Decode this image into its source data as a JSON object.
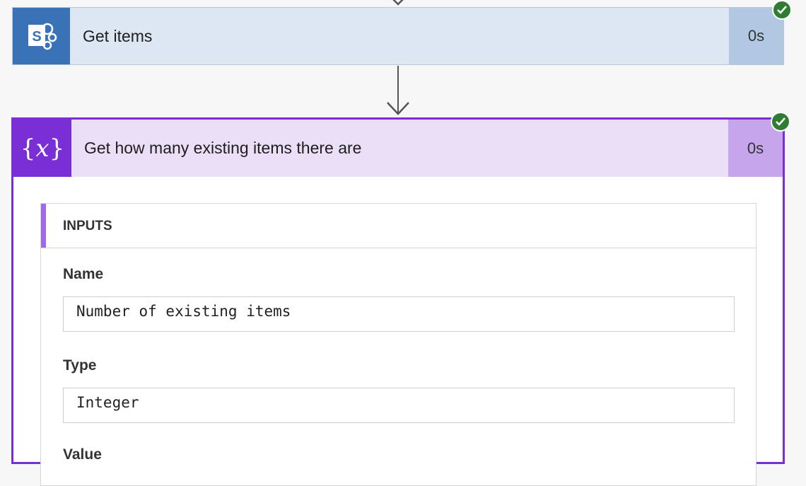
{
  "flow": {
    "step1": {
      "icon": "sharepoint-icon",
      "title": "Get items",
      "duration": "0s",
      "status": "succeeded",
      "accent_color": "#3a72b8"
    },
    "step2": {
      "icon": "variable-icon",
      "icon_glyph": "{𝑥}",
      "title": "Get how many existing items there are",
      "duration": "0s",
      "status": "succeeded",
      "accent_color": "#7a2ed6",
      "inputs": {
        "header": "INPUTS",
        "fields": [
          {
            "label": "Name",
            "value": "Number of existing items"
          },
          {
            "label": "Type",
            "value": "Integer"
          },
          {
            "label": "Value",
            "value": ""
          }
        ]
      }
    }
  }
}
